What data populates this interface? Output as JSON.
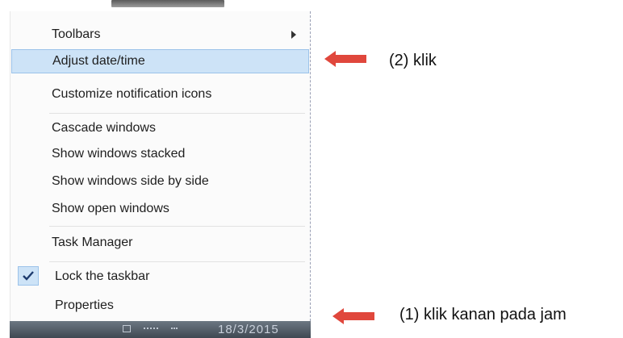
{
  "context_menu": {
    "items": [
      {
        "label": "Toolbars"
      },
      {
        "label": "Adjust date/time"
      },
      {
        "label": "Customize notification icons"
      },
      {
        "label": "Cascade windows"
      },
      {
        "label": "Show windows stacked"
      },
      {
        "label": "Show windows side by side"
      },
      {
        "label": "Show open windows"
      },
      {
        "label": "Task Manager"
      },
      {
        "label": "Lock the taskbar",
        "checked": true
      },
      {
        "label": "Properties"
      }
    ],
    "highlighted_item": "Adjust date/time"
  },
  "taskbar": {
    "clock": "18/3/2015"
  },
  "annotations": {
    "step2": "(2) klik",
    "step1": "(1) klik kanan pada jam"
  },
  "colors": {
    "arrow": "#e0473c",
    "highlight": "#cde3f7"
  }
}
